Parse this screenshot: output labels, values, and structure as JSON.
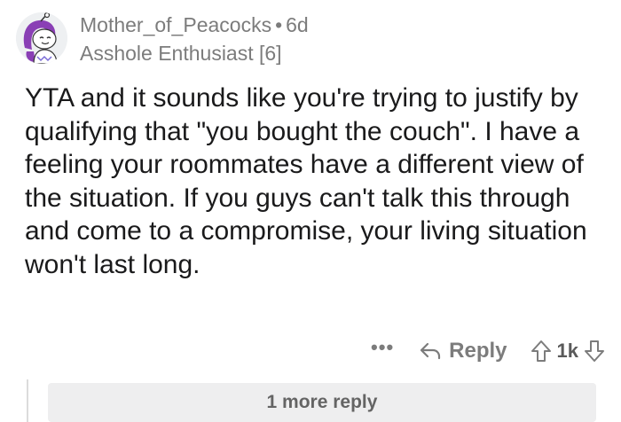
{
  "comment": {
    "author": "Mother_of_Peacocks",
    "separator": "•",
    "age": "6d",
    "flair": "Asshole Enthusiast [6]",
    "text": "YTA and it sounds like you're trying to justify by qualifying that \"you bought the couch\". I have a feeling your roommates have a different view of the situation. If you guys can't talk this through and come to a compromise, your living situation won't last long."
  },
  "actions": {
    "more_label": "•••",
    "reply_label": "Reply",
    "vote_count": "1k"
  },
  "thread": {
    "more_replies_label": "1 more reply"
  },
  "colors": {
    "meta_gray": "#7c7c7c",
    "text": "#1a1a1b",
    "more_replies_bg": "#eeeeef"
  }
}
